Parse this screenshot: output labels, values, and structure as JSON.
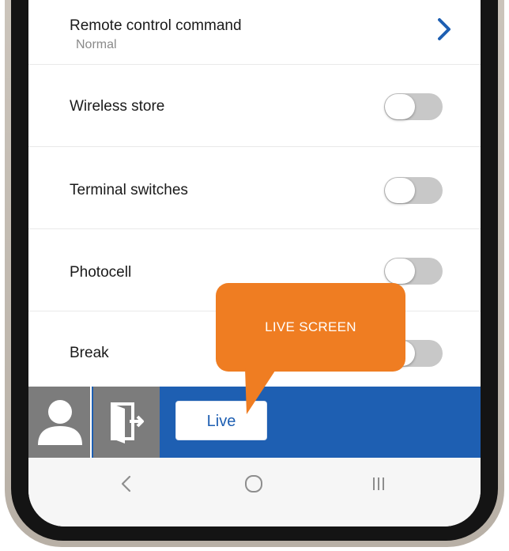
{
  "settings": {
    "remote_control": {
      "label": "Remote control command",
      "value": "Normal"
    },
    "wireless_store": {
      "label": "Wireless store"
    },
    "terminal_switches": {
      "label": "Terminal switches"
    },
    "photocell": {
      "label": "Photocell"
    },
    "break": {
      "label": "Break"
    }
  },
  "toggles": {
    "wireless_store": false,
    "terminal_switches": false,
    "photocell": false,
    "break": false
  },
  "toolbar": {
    "live_label": "Live"
  },
  "callout": {
    "text": "LIVE SCREEN"
  },
  "icons": {
    "chevron": "chevron-right-icon",
    "user": "user-icon",
    "exit": "exit-door-icon",
    "nav_back": "back-icon",
    "nav_home": "home-icon",
    "nav_recents": "recents-icon"
  },
  "colors": {
    "accent_blue": "#1e5fb2",
    "callout_orange": "#ef7d22",
    "toggle_off": "#c8c8c8",
    "toolbar_gray": "#7c7c7c"
  }
}
